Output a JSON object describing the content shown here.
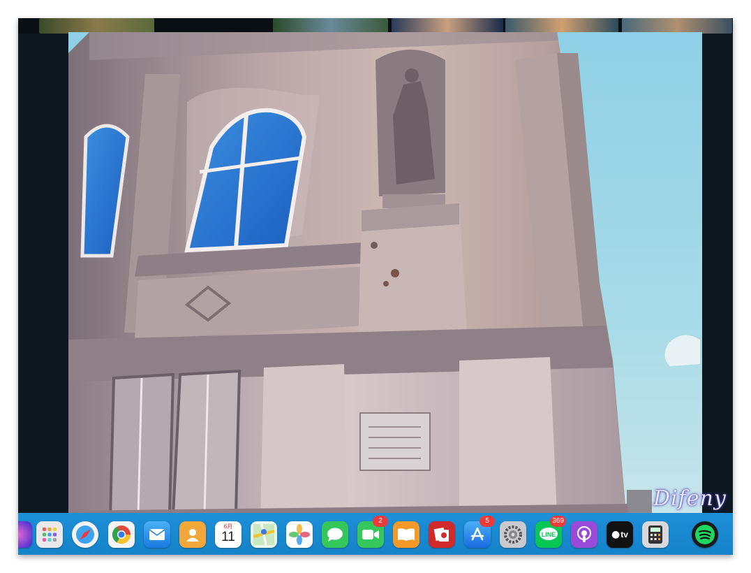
{
  "watermark": "Difeny",
  "dock": {
    "calendar": {
      "month": "6月",
      "day": "11"
    },
    "facetime_badge": "2",
    "appstore_badge": "5",
    "line_badge": "369",
    "line_label": "LINE",
    "tv_label": "tv"
  },
  "icons": [
    "siri-icon",
    "launchpad-icon",
    "safari-icon",
    "chrome-icon",
    "mail-icon",
    "contacts-icon",
    "calendar-icon",
    "maps-icon",
    "photos-icon",
    "messages-icon",
    "facetime-icon",
    "books-icon",
    "photo-booth-icon",
    "app-store-icon",
    "system-settings-icon",
    "line-icon",
    "podcasts-icon",
    "apple-tv-icon",
    "calculator-icon",
    "spotify-icon"
  ]
}
